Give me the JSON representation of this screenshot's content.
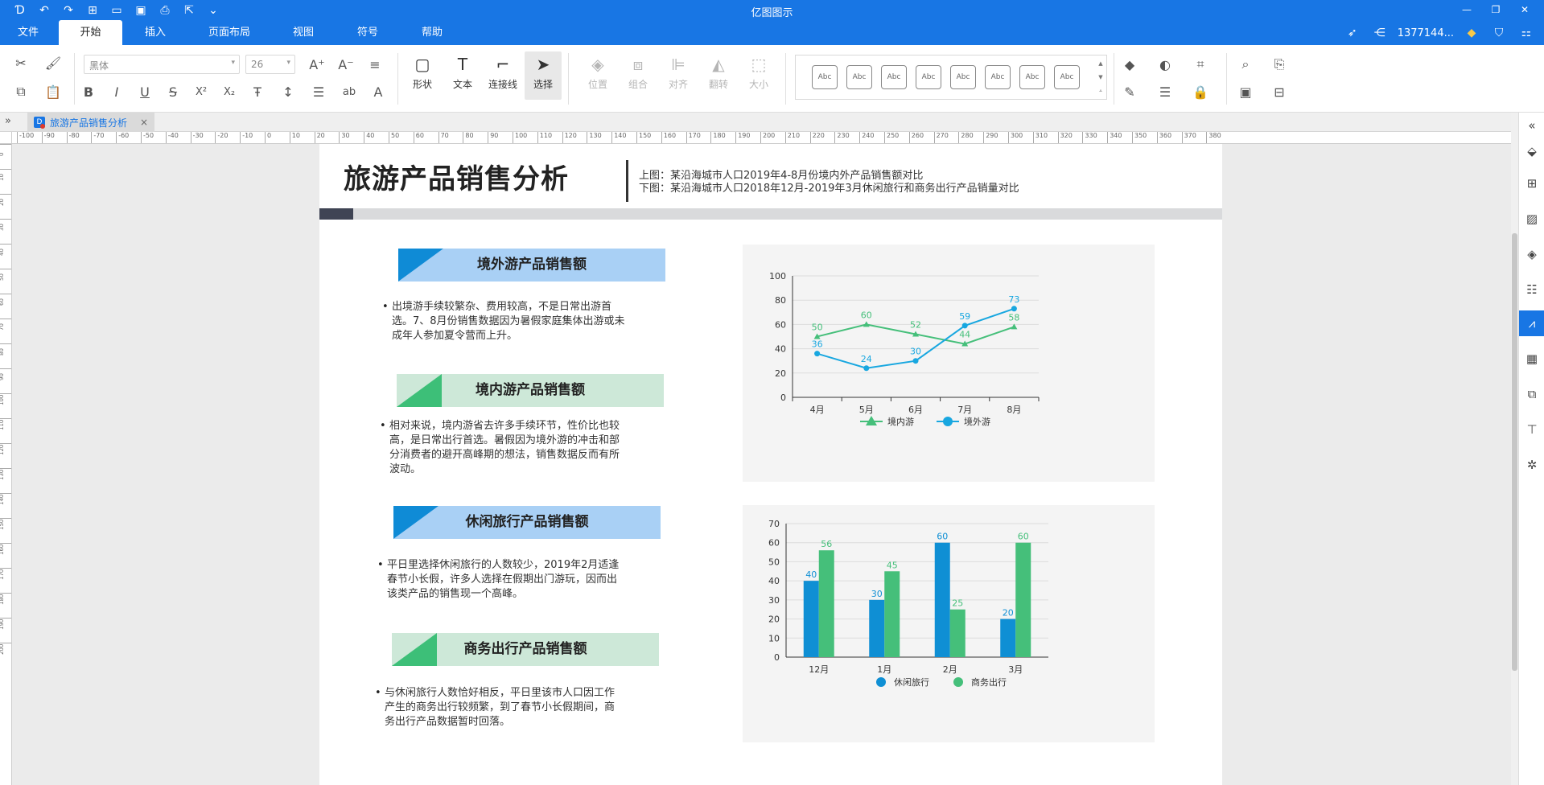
{
  "app": {
    "title": "亿图图示",
    "user": "1377144...",
    "menu": [
      {
        "label": "文件",
        "active": false
      },
      {
        "label": "开始",
        "active": true
      },
      {
        "label": "插入",
        "active": false
      },
      {
        "label": "页面布局",
        "active": false
      },
      {
        "label": "视图",
        "active": false
      },
      {
        "label": "符号",
        "active": false
      },
      {
        "label": "帮助",
        "active": false
      }
    ]
  },
  "ribbon": {
    "font_family": "黑体",
    "font_size": "26",
    "tools": {
      "shape": "形状",
      "text": "文本",
      "connector": "连接线",
      "select": "选择",
      "position": "位置",
      "group": "组合",
      "align": "对齐",
      "flip": "翻转",
      "size": "大小"
    },
    "style_presets": [
      "Abc",
      "Abc",
      "Abc",
      "Abc",
      "Abc",
      "Abc",
      "Abc",
      "Abc"
    ]
  },
  "doc_tab": {
    "name": "旅游产品销售分析",
    "close": "×"
  },
  "ruler": {
    "h_ticks": [
      "-100",
      "-90",
      "-80",
      "-70",
      "-60",
      "-50",
      "-40",
      "-30",
      "-20",
      "-10",
      "0",
      "10",
      "20",
      "30",
      "40",
      "50",
      "60",
      "70",
      "80",
      "90",
      "100",
      "110",
      "120",
      "130",
      "140",
      "150",
      "160",
      "170",
      "180",
      "190",
      "200",
      "210",
      "220",
      "230",
      "240",
      "250",
      "260",
      "270",
      "280",
      "290",
      "300",
      "310",
      "320",
      "330",
      "340",
      "350",
      "360",
      "370",
      "380"
    ],
    "v_ticks": [
      "0",
      "10",
      "20",
      "30",
      "40",
      "50",
      "60",
      "70",
      "80",
      "90",
      "100",
      "110",
      "120",
      "130",
      "140",
      "150",
      "160",
      "170",
      "180",
      "190",
      "200"
    ]
  },
  "page": {
    "title": "旅游产品销售分析",
    "subtitle_1": "上图：某沿海城市人口2019年4-8月份境内外产品销售额对比",
    "subtitle_2": "下图：某沿海城市人口2018年12月-2019年3月休闲旅行和商务出行产品销量对比",
    "sections": [
      {
        "heading": "境外游产品销售额",
        "text": "出境游手续较繁杂、费用较高，不是日常出游首选。7、8月份销售数据因为暑假家庭集体出游或未成年人参加夏令营而上升。"
      },
      {
        "heading": "境内游产品销售额",
        "text": "相对来说，境内游省去许多手续环节，性价比也较高，是日常出行首选。暑假因为境外游的冲击和部分消费者的避开高峰期的想法，销售数据反而有所波动。"
      },
      {
        "heading": "休闲旅行产品销售额",
        "text": "平日里选择休闲旅行的人数较少，2019年2月适逢春节小长假，许多人选择在假期出门游玩，因而出该类产品的销售现一个高峰。"
      },
      {
        "heading": "商务出行产品销售额",
        "text": "与休闲旅行人数恰好相反，平日里该市人口因工作产生的商务出行较频繁，到了春节小长假期间，商务出行产品数据暂时回落。"
      }
    ]
  },
  "colors": {
    "titlebar": "#1876e4",
    "blue_series": "#18a7e0",
    "green_series": "#45bf7a",
    "bar_blue": "#0f8fd4",
    "bar_green": "#45bf7a"
  },
  "chart_data": [
    {
      "type": "line",
      "categories": [
        "4月",
        "5月",
        "6月",
        "7月",
        "8月"
      ],
      "series": [
        {
          "name": "境内游",
          "values": [
            50,
            60,
            52,
            44,
            58
          ],
          "color": "#45bf7a",
          "marker": "triangle"
        },
        {
          "name": "境外游",
          "values": [
            36,
            24,
            30,
            59,
            73
          ],
          "color": "#18a7e0",
          "marker": "circle"
        }
      ],
      "ylim": [
        0,
        100
      ],
      "yticks": [
        "0",
        "20",
        "40",
        "60",
        "80",
        "100"
      ],
      "grid": true,
      "legend": "bottom"
    },
    {
      "type": "bar",
      "categories": [
        "12月",
        "1月",
        "2月",
        "3月"
      ],
      "series": [
        {
          "name": "休闲旅行",
          "values": [
            40,
            30,
            60,
            20
          ],
          "color": "#0f8fd4"
        },
        {
          "name": "商务出行",
          "values": [
            56,
            45,
            25,
            60
          ],
          "color": "#45bf7a"
        }
      ],
      "ylim": [
        0,
        70
      ],
      "yticks": [
        "0",
        "10",
        "20",
        "30",
        "40",
        "50",
        "60",
        "70"
      ],
      "grid": true,
      "legend": "bottom"
    }
  ]
}
